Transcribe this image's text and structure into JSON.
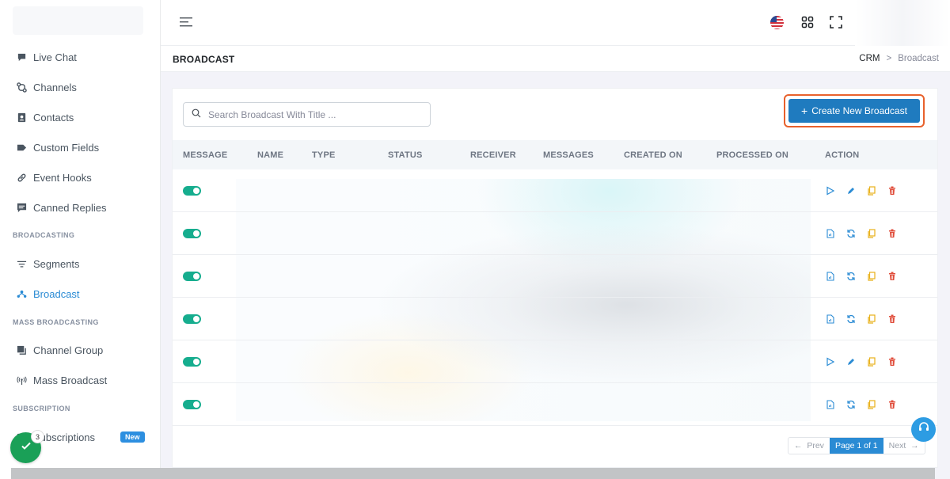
{
  "sidebar": {
    "items": [
      {
        "label": "Live Chat",
        "icon": "chat-icon"
      },
      {
        "label": "Channels",
        "icon": "route-icon"
      },
      {
        "label": "Contacts",
        "icon": "contact-card-icon"
      },
      {
        "label": "Custom Fields",
        "icon": "tag-icon"
      },
      {
        "label": "Event Hooks",
        "icon": "link-icon"
      },
      {
        "label": "Canned Replies",
        "icon": "message-icon"
      }
    ],
    "sections": {
      "broadcasting": "BROADCASTING",
      "mass_broadcasting": "MASS BROADCASTING",
      "subscription": "SUBSCRIPTION"
    },
    "broadcasting_items": [
      {
        "label": "Segments",
        "icon": "filter-icon"
      },
      {
        "label": "Broadcast",
        "icon": "broadcast-icon",
        "active": true
      }
    ],
    "mass_items": [
      {
        "label": "Channel Group",
        "icon": "stack-icon"
      },
      {
        "label": "Mass Broadcast",
        "icon": "antenna-icon"
      }
    ],
    "subscription_items": [
      {
        "label": "Subscriptions",
        "icon": "subscriptions-icon",
        "badge": "New"
      }
    ],
    "active_color": "#2a8bd4"
  },
  "page": {
    "title": "BROADCAST",
    "breadcrumb": {
      "parent": "CRM",
      "separator": ">",
      "current": "Broadcast"
    }
  },
  "toolbar": {
    "search_placeholder": "Search Broadcast With Title ...",
    "create_label": "Create New Broadcast",
    "create_color": "#1f7bbf",
    "highlight_color": "#e8612c"
  },
  "table": {
    "columns": [
      "MESSAGE",
      "NAME",
      "TYPE",
      "STATUS",
      "RECEIVER",
      "MESSAGES",
      "CREATED ON",
      "PROCESSED ON",
      "ACTION"
    ],
    "rows": [
      {
        "message_enabled": true,
        "actions": [
          "play-icon",
          "edit-icon",
          "copy-icon",
          "delete-icon"
        ]
      },
      {
        "message_enabled": true,
        "actions": [
          "report-icon",
          "refresh-icon",
          "copy-icon",
          "delete-icon"
        ]
      },
      {
        "message_enabled": true,
        "actions": [
          "report-icon",
          "refresh-icon",
          "copy-icon",
          "delete-icon"
        ]
      },
      {
        "message_enabled": true,
        "actions": [
          "report-icon",
          "refresh-icon",
          "copy-icon",
          "delete-icon"
        ]
      },
      {
        "message_enabled": true,
        "actions": [
          "play-icon",
          "edit-icon",
          "copy-icon",
          "delete-icon"
        ]
      },
      {
        "message_enabled": true,
        "actions": [
          "report-icon",
          "refresh-icon",
          "copy-icon",
          "delete-icon"
        ]
      }
    ]
  },
  "pagination": {
    "prev": "Prev",
    "page_info": "Page 1 of 1",
    "next": "Next"
  },
  "floating": {
    "notification_count": "3"
  }
}
